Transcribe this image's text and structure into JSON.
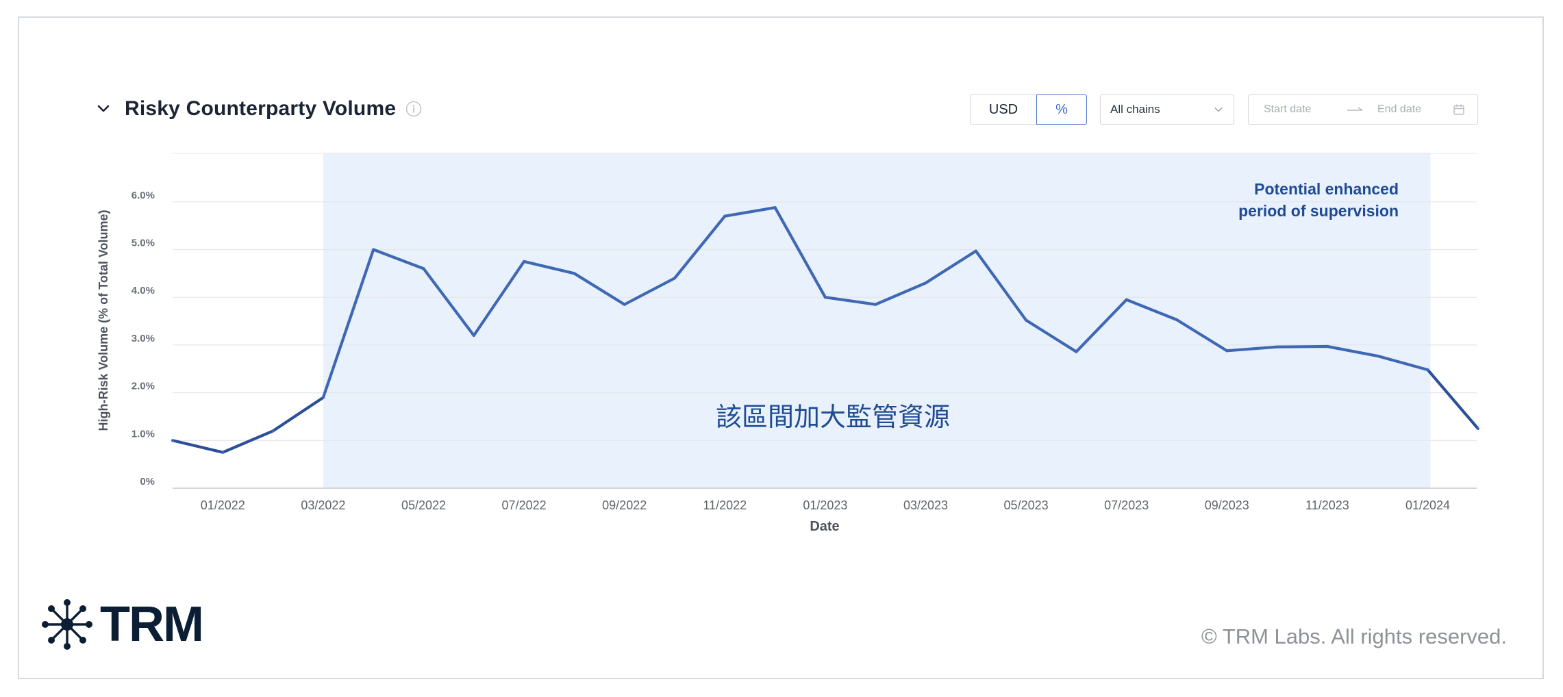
{
  "panel": {
    "title": "Risky Counterparty Volume",
    "unit_usd": "USD",
    "unit_pct": "%",
    "chain_select": "All chains",
    "start_placeholder": "Start date",
    "end_placeholder": "End date"
  },
  "footer": {
    "logo": "TRM",
    "copyright": "© TRM Labs. All rights reserved."
  },
  "colors": {
    "line": "#3f68b4",
    "line_outside": "#2b4f99",
    "shade": "#e9f1fc",
    "annotation": "#1f4b94"
  },
  "chart_data": {
    "type": "line",
    "xlabel": "Date",
    "ylabel": "High-Risk Volume (% of Total Volume)",
    "ylim": [
      0,
      7
    ],
    "y_ticks": [
      "0%",
      "1.0%",
      "2.0%",
      "3.0%",
      "4.0%",
      "5.0%",
      "6.0%"
    ],
    "x_tick_labels": [
      "01/2022",
      "03/2022",
      "05/2022",
      "07/2022",
      "09/2022",
      "11/2022",
      "01/2023",
      "03/2023",
      "05/2023",
      "07/2023",
      "09/2023",
      "11/2023",
      "01/2024"
    ],
    "x": [
      "12/2021",
      "01/2022",
      "02/2022",
      "03/2022",
      "04/2022",
      "05/2022",
      "06/2022",
      "07/2022",
      "08/2022",
      "09/2022",
      "10/2022",
      "11/2022",
      "12/2022",
      "01/2023",
      "02/2023",
      "03/2023",
      "04/2023",
      "05/2023",
      "06/2023",
      "07/2023",
      "08/2023",
      "09/2023",
      "10/2023",
      "11/2023",
      "12/2023",
      "01/2024",
      "02/2024"
    ],
    "values": [
      1.0,
      0.75,
      1.2,
      1.9,
      5.0,
      4.6,
      3.2,
      4.75,
      4.5,
      3.85,
      4.4,
      5.7,
      5.88,
      4.0,
      3.85,
      4.3,
      4.97,
      3.52,
      2.86,
      3.95,
      3.53,
      2.88,
      2.96,
      2.97,
      2.77,
      2.48,
      1.25
    ],
    "shaded_region": [
      "03/2022",
      "01/2024"
    ],
    "annotations": [
      "Potential enhanced period of supervision",
      "該區間加大監管資源"
    ],
    "grid": true
  }
}
